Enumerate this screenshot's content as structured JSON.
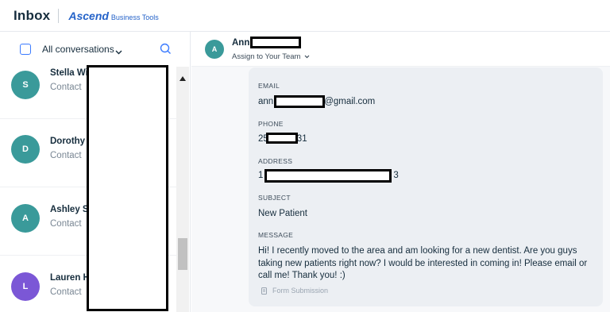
{
  "header": {
    "title": "Inbox",
    "brand_name": "Ascend",
    "brand_sub": "Business Tools"
  },
  "filter": {
    "label": "All conversations",
    "chevron_icon": "chevron-down-icon",
    "search_icon": "search-icon"
  },
  "conversations": [
    {
      "initial": "S",
      "name": "Stella Wi",
      "subtitle": "Contact",
      "color": "#3a9a9a"
    },
    {
      "initial": "D",
      "name": "Dorothy",
      "subtitle": "Contact",
      "color": "#3a9a9a"
    },
    {
      "initial": "A",
      "name": "Ashley S",
      "subtitle": "Contact",
      "color": "#3a9a9a"
    },
    {
      "initial": "L",
      "name": "Lauren H",
      "subtitle": "Contact",
      "color": "#7b57d6"
    }
  ],
  "conversation": {
    "avatar_initial": "A",
    "name": "Ann",
    "assign_label": "Assign to Your Team"
  },
  "form": {
    "email_label": "EMAIL",
    "email_prefix": "ann",
    "email_suffix": "@gmail.com",
    "phone_label": "PHONE",
    "phone_prefix": "25",
    "phone_suffix": "31",
    "address_label": "ADDRESS",
    "address_prefix": "1",
    "address_suffix": "3",
    "subject_label": "SUBJECT",
    "subject_value": "New Patient",
    "message_label": "MESSAGE",
    "message_value": "Hi! I recently moved to the area and am looking for a new dentist. Are you guys taking new patients right now? I would be interested in coming in! Please email or call me! Thank you! :)",
    "footer_label": "Form Submission"
  },
  "colors": {
    "accent": "#3b7bff",
    "brand": "#2563c9",
    "teal_avatar": "#3a9a9a",
    "purple_avatar": "#7b57d6"
  }
}
